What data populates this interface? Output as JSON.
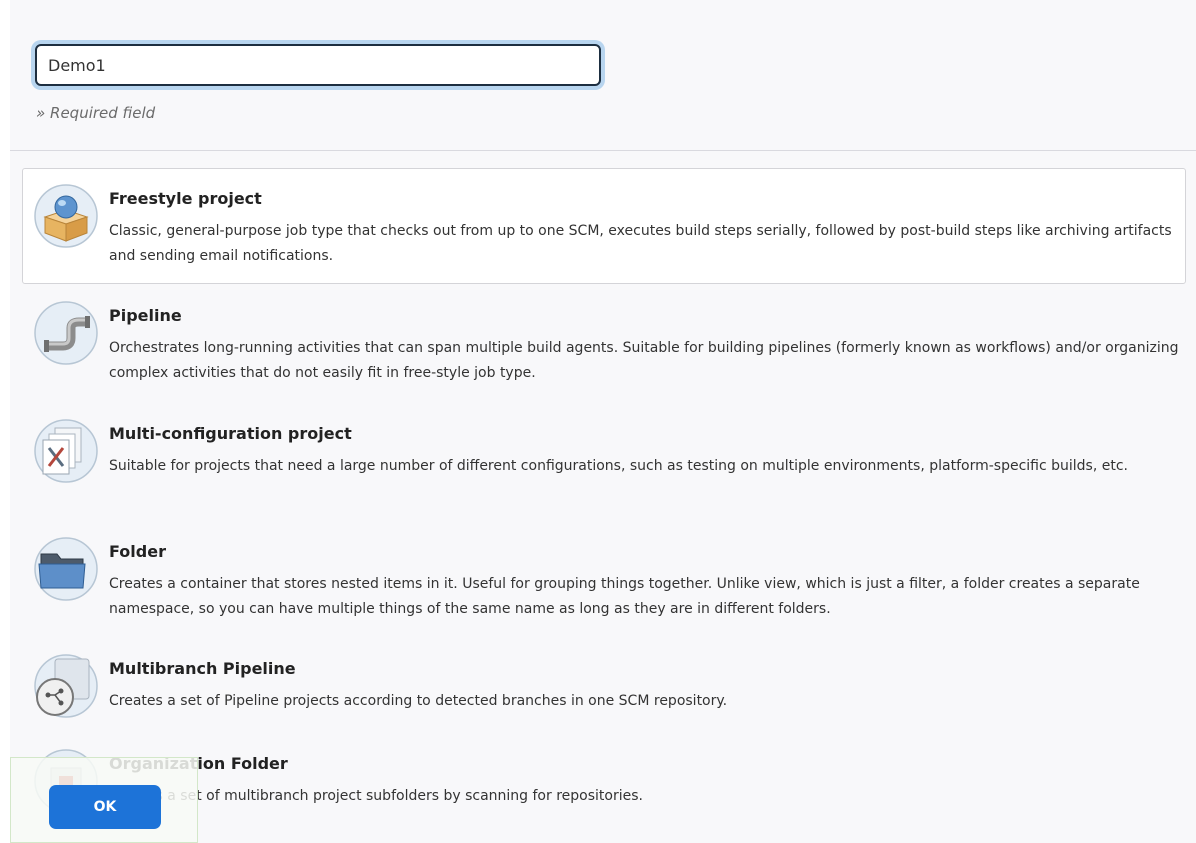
{
  "item_name": {
    "value": "Demo1",
    "required_hint": "» Required field"
  },
  "job_types": [
    {
      "title": "Freestyle project",
      "description": "Classic, general-purpose job type that checks out from up to one SCM, executes build steps serially, followed by post-build steps like archiving artifacts and sending email notifications.",
      "icon": "freestyle-package-icon"
    },
    {
      "title": "Pipeline",
      "description": "Orchestrates long-running activities that can span multiple build agents. Suitable for building pipelines (formerly known as workflows) and/or organizing complex activities that do not easily fit in free-style job type.",
      "icon": "pipeline-pipe-icon"
    },
    {
      "title": "Multi-configuration project",
      "description": "Suitable for projects that need a large number of different configurations, such as testing on multiple environments, platform-specific builds, etc.",
      "icon": "multi-configuration-tools-icon"
    },
    {
      "title": "Folder",
      "description": "Creates a container that stores nested items in it. Useful for grouping things together. Unlike view, which is just a filter, a folder creates a separate namespace, so you can have multiple things of the same name as long as they are in different folders.",
      "icon": "folder-icon"
    },
    {
      "title": "Multibranch Pipeline",
      "description": "Creates a set of Pipeline projects according to detected branches in one SCM repository.",
      "icon": "multibranch-branch-icon"
    },
    {
      "title": "Organization Folder",
      "description": "Creates a set of multibranch project subfolders by scanning for repositories.",
      "icon": "organization-folder-icon"
    }
  ],
  "ok_button": {
    "label": "OK"
  },
  "colors": {
    "accent": "#1d73d8",
    "panel_background": "#f8f8fa",
    "input_focus_ring": "#b8d5ef"
  }
}
